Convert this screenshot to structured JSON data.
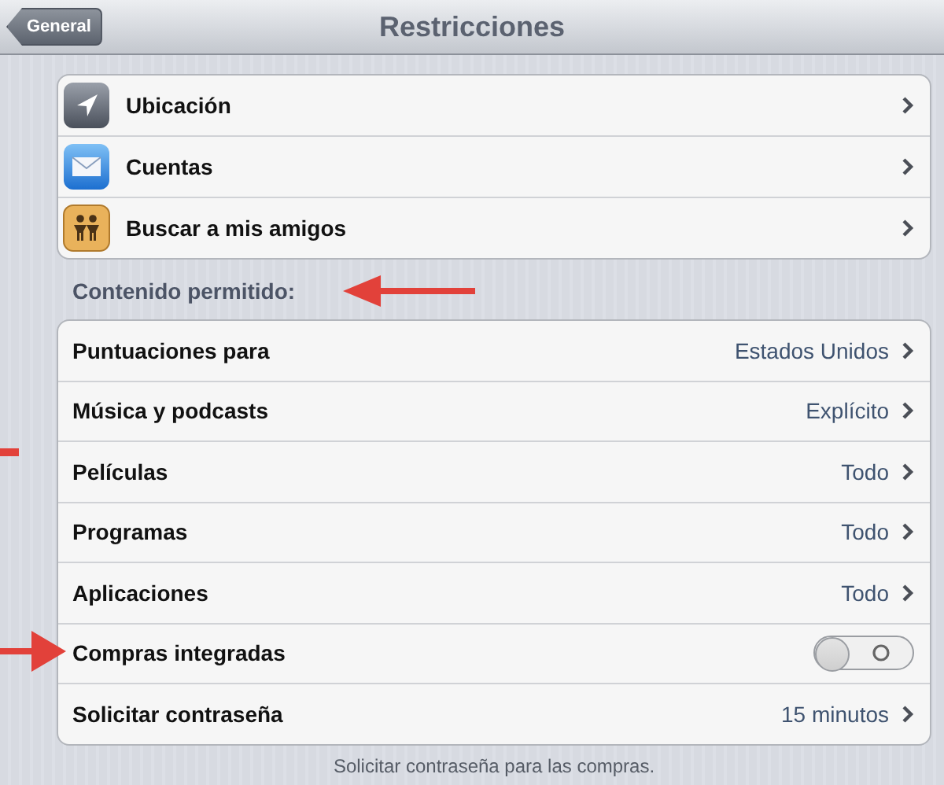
{
  "nav_bar": {
    "back_button": "General",
    "title": "Restricciones"
  },
  "privacy_group": [
    {
      "label": "Ubicación"
    },
    {
      "label": "Cuentas"
    },
    {
      "label": "Buscar a mis amigos"
    }
  ],
  "content_header": "Contenido permitido:",
  "content_group": [
    {
      "kind": "link",
      "label": "Puntuaciones para",
      "value": "Estados Unidos"
    },
    {
      "kind": "link",
      "label": "Música y podcasts",
      "value": "Explícito"
    },
    {
      "kind": "link",
      "label": "Películas",
      "value": "Todo"
    },
    {
      "kind": "link",
      "label": "Programas",
      "value": "Todo"
    },
    {
      "kind": "link",
      "label": "Aplicaciones",
      "value": "Todo"
    },
    {
      "kind": "toggle",
      "label": "Compras integradas",
      "on": false
    },
    {
      "kind": "link",
      "label": "Solicitar contraseña",
      "value": "15 minutos"
    }
  ],
  "footer_note": "Solicitar contraseña para las compras."
}
